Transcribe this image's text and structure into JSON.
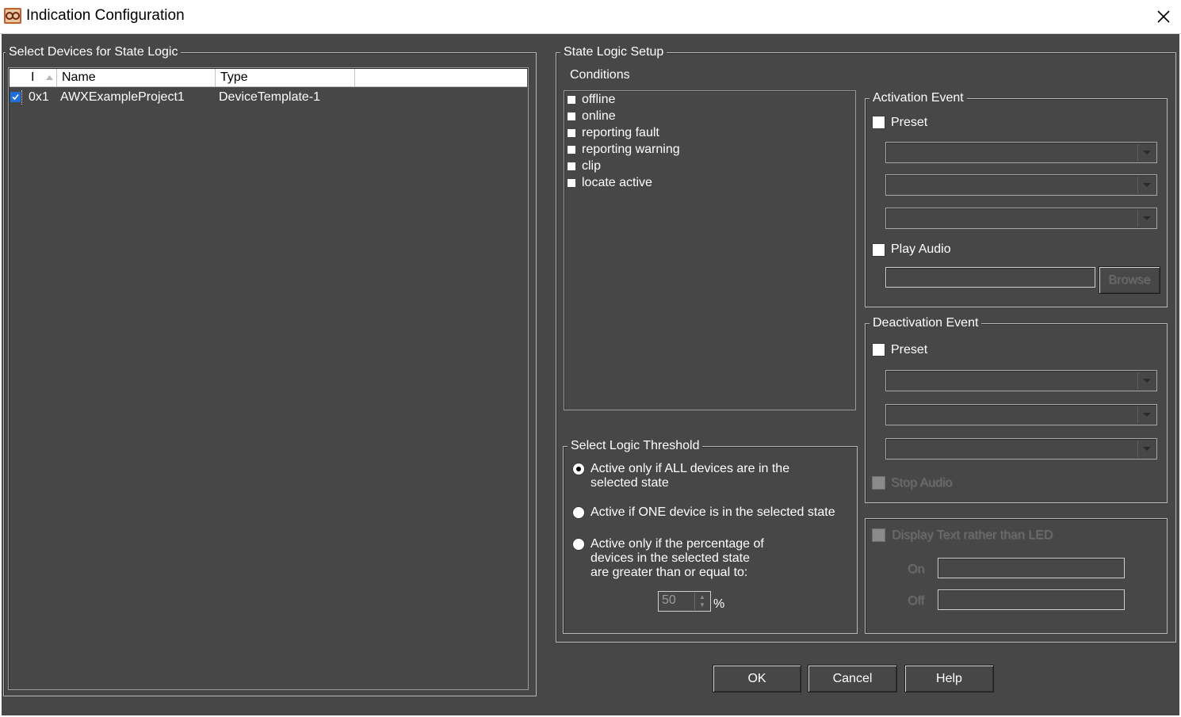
{
  "window": {
    "title": "Indication Configuration"
  },
  "devices": {
    "group_label": "Select Devices for State Logic",
    "columns": [
      "I",
      "Name",
      "Type"
    ],
    "rows": [
      {
        "checked": true,
        "id": "0x1",
        "name": "AWXExampleProject1",
        "type": "DeviceTemplate-1"
      }
    ]
  },
  "setup": {
    "group_label": "State Logic Setup",
    "conditions_label": "Conditions",
    "conditions": [
      "offline",
      "online",
      "reporting fault",
      "reporting warning",
      "clip",
      "locate active"
    ]
  },
  "threshold": {
    "group_label": "Select Logic Threshold",
    "options": [
      {
        "line1": "Active only if ALL devices are in the",
        "line2": "selected state",
        "line3": "",
        "selected": true
      },
      {
        "line1": "Active if ONE device is in the selected state",
        "line2": "",
        "line3": "",
        "selected": false
      },
      {
        "line1": "Active only if the percentage of",
        "line2": "devices in the selected state",
        "line3": "are greater than or equal to:",
        "selected": false
      }
    ],
    "percent_value": "50",
    "percent_unit": "%"
  },
  "activation": {
    "group_label": "Activation Event",
    "preset_label": "Preset",
    "play_audio_label": "Play Audio",
    "browse_label": "Browse"
  },
  "deactivation": {
    "group_label": "Deactivation Event",
    "preset_label": "Preset",
    "stop_audio_label": "Stop Audio"
  },
  "display": {
    "label": "Display Text rather than LED",
    "on_label": "On",
    "off_label": "Off"
  },
  "buttons": {
    "ok": "OK",
    "cancel": "Cancel",
    "help": "Help"
  },
  "colors": {
    "background": "#474747",
    "titlebar": "#ffffff",
    "check_accent": "#1e6fd9"
  }
}
